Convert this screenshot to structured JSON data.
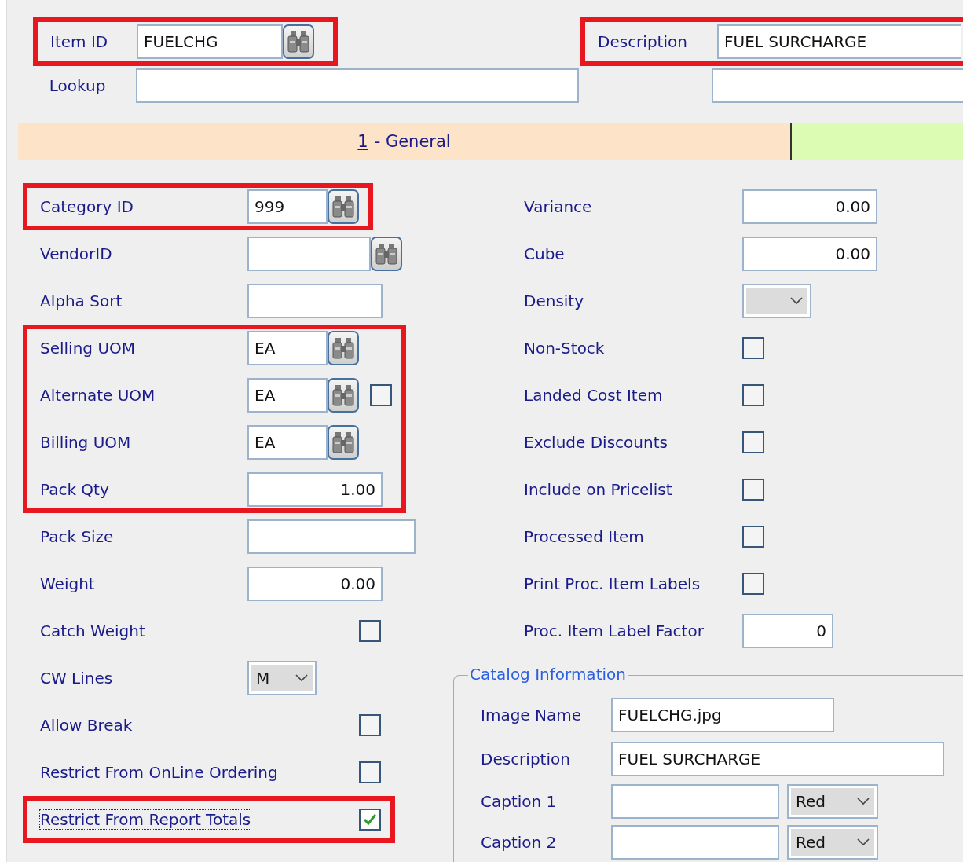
{
  "header": {
    "item_id": {
      "label": "Item ID",
      "value": "FUELCHG",
      "highlighted": true
    },
    "description": {
      "label": "Description",
      "value": "FUEL SURCHARGE",
      "highlighted": true
    },
    "lookup": {
      "label": "Lookup"
    }
  },
  "tabs": [
    {
      "key": "1",
      "label": "- General",
      "selected": true
    },
    {
      "selected": false
    }
  ],
  "left_groups": [
    {
      "highlighted": true,
      "fields": [
        {
          "kind": "lookup",
          "label": "Category ID",
          "value": "999"
        }
      ]
    },
    {
      "highlighted": false,
      "fields": [
        {
          "kind": "lookup",
          "label": "VendorID"
        },
        {
          "kind": "text",
          "label": "Alpha Sort"
        }
      ]
    },
    {
      "highlighted": true,
      "fields": [
        {
          "kind": "lookup",
          "label": "Selling UOM",
          "value": "EA"
        },
        {
          "kind": "lookup",
          "label": "Alternate UOM",
          "value": "EA",
          "extra_checked": false
        },
        {
          "kind": "lookup",
          "label": "Billing UOM",
          "value": "EA"
        },
        {
          "kind": "text",
          "label": "Pack Qty",
          "value": "1.00",
          "numeric": true
        }
      ]
    },
    {
      "highlighted": false,
      "fields": [
        {
          "kind": "text",
          "label": "Pack Size"
        },
        {
          "kind": "text",
          "label": "Weight",
          "value": "0.00",
          "numeric": true
        },
        {
          "kind": "checkbox",
          "label": "Catch Weight",
          "checked": false
        },
        {
          "kind": "select",
          "label": "CW Lines",
          "value": "M"
        },
        {
          "kind": "checkbox",
          "label": "Allow Break",
          "checked": false
        },
        {
          "kind": "checkbox",
          "label": "Restrict From OnLine Ordering",
          "checked": false
        }
      ]
    },
    {
      "highlighted": true,
      "fields": [
        {
          "kind": "checkbox",
          "label": "Restrict From Report Totals",
          "checked": true,
          "focused": true
        }
      ]
    }
  ],
  "right_fields": [
    {
      "kind": "text",
      "label": "Variance",
      "value": "0.00",
      "numeric": true
    },
    {
      "kind": "text",
      "label": "Cube",
      "value": "0.00",
      "numeric": true
    },
    {
      "kind": "select",
      "label": "Density"
    },
    {
      "kind": "checkbox",
      "label": "Non-Stock",
      "checked": false
    },
    {
      "kind": "checkbox",
      "label": "Landed Cost Item",
      "checked": false
    },
    {
      "kind": "checkbox",
      "label": "Exclude Discounts",
      "checked": false
    },
    {
      "kind": "checkbox",
      "label": "Include on Pricelist",
      "checked": false
    },
    {
      "kind": "checkbox",
      "label": "Processed Item",
      "checked": false
    },
    {
      "kind": "checkbox",
      "label": "Print Proc. Item Labels",
      "checked": false
    },
    {
      "kind": "text",
      "label": "Proc. Item Label Factor",
      "value": "0",
      "numeric": true
    }
  ],
  "catalog": {
    "title": "Catalog Information",
    "fields": [
      {
        "kind": "text",
        "label": "Image Name",
        "value": "FUELCHG.jpg"
      },
      {
        "kind": "long_text",
        "label": "Description",
        "value": "FUEL SURCHARGE"
      },
      {
        "kind": "caption",
        "label": "Caption 1",
        "color_choice": "Red"
      },
      {
        "kind": "caption",
        "label": "Caption 2",
        "color_choice": "Red"
      }
    ]
  }
}
